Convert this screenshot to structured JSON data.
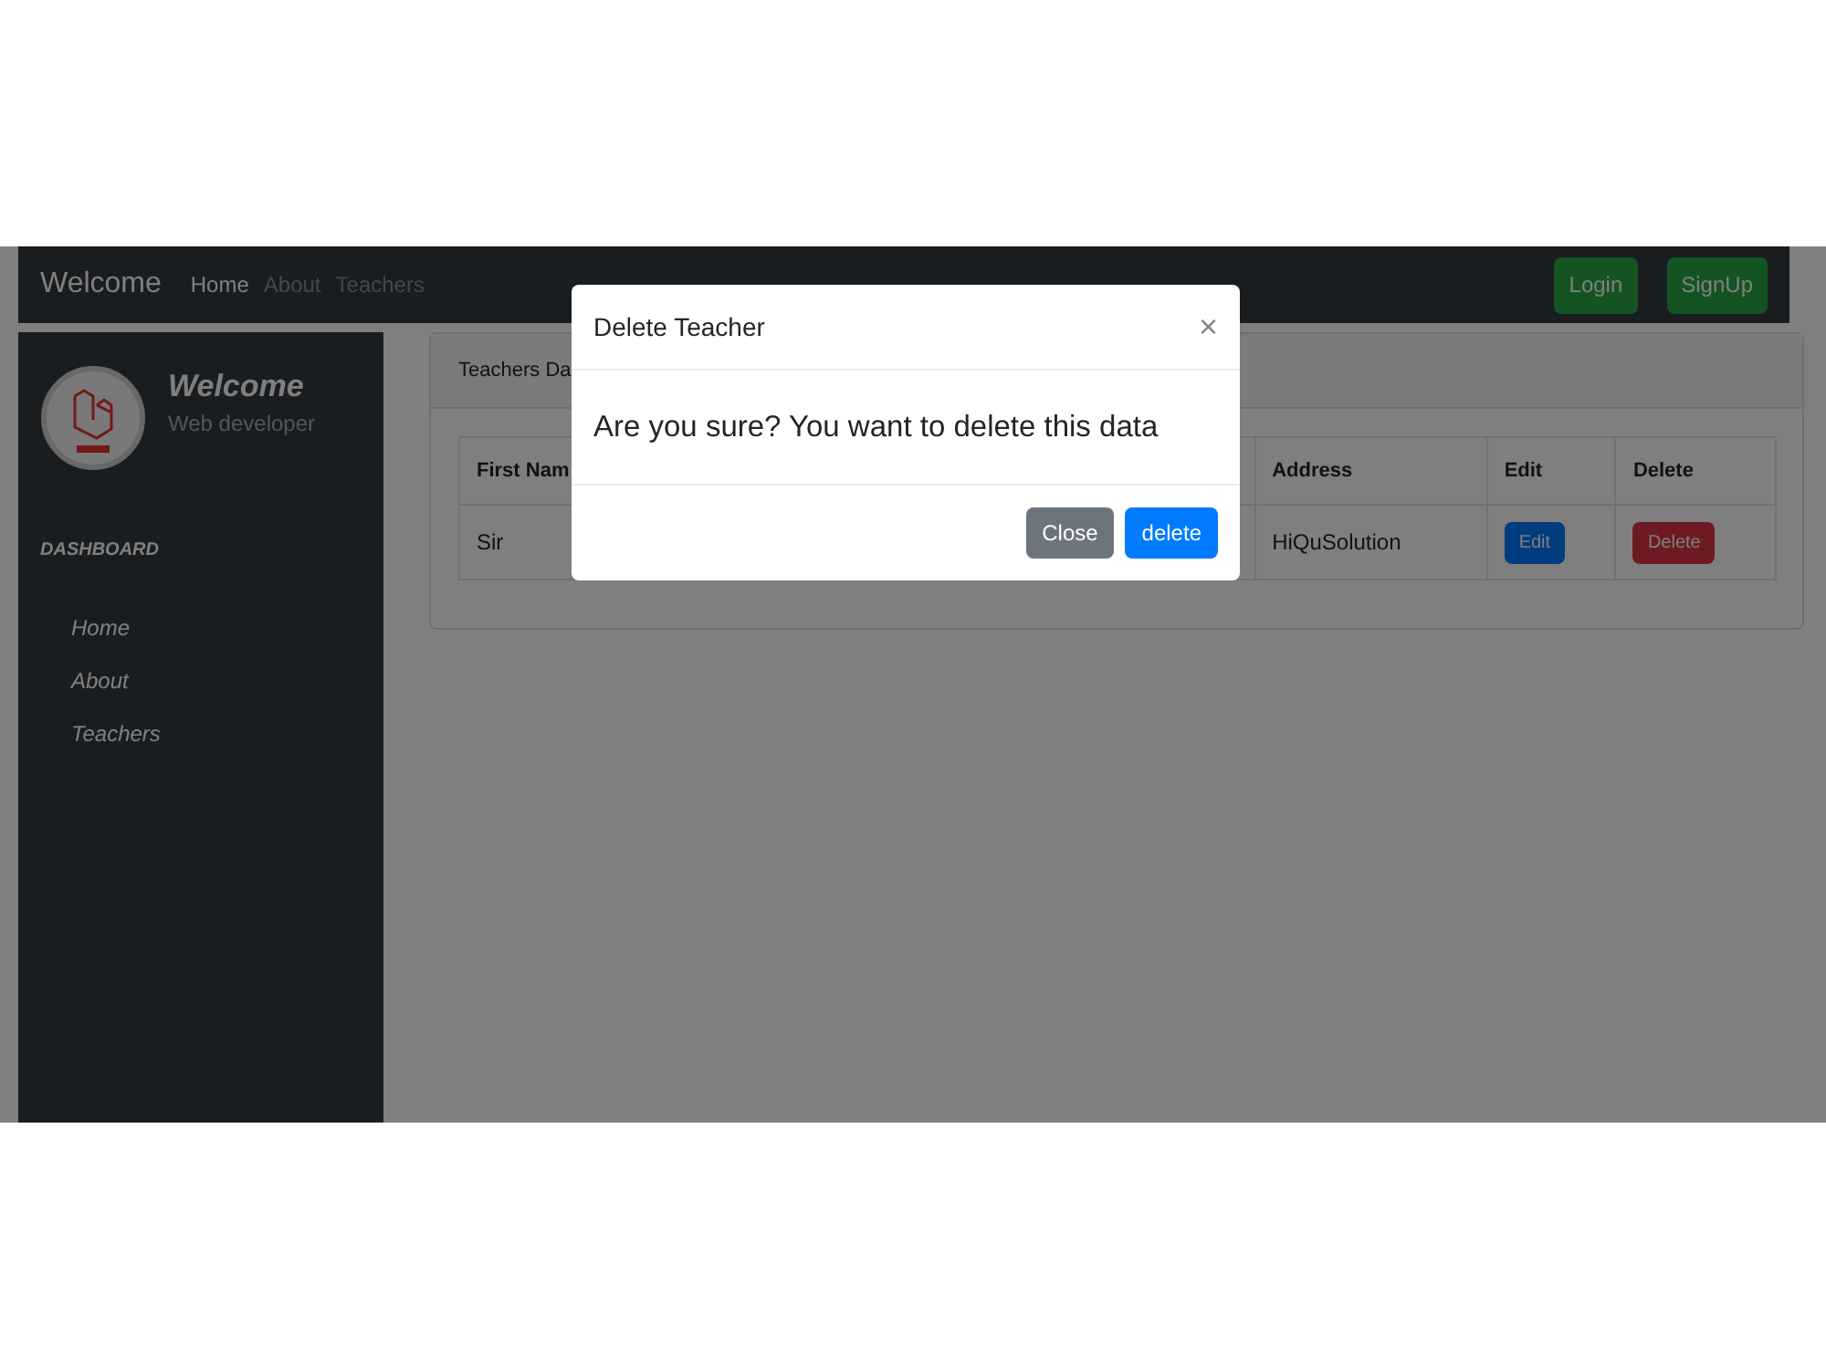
{
  "navbar": {
    "brand": "Welcome",
    "links": [
      {
        "label": "Home",
        "selected": true
      },
      {
        "label": "About",
        "selected": false
      },
      {
        "label": "Teachers",
        "selected": false
      }
    ],
    "buttons": [
      "Login",
      "SignUp"
    ]
  },
  "sidebar": {
    "title": "Welcome",
    "subtitle": "Web developer",
    "section": "DASHBOARD",
    "items": [
      "Home",
      "About",
      "Teachers"
    ]
  },
  "card": {
    "header": "Teachers Da"
  },
  "table": {
    "columns": [
      "First Nam",
      "Address",
      "Edit",
      "Delete"
    ],
    "rows": [
      {
        "cells": [
          {
            "kind": "text",
            "text": "Sir"
          },
          {
            "kind": "text",
            "text": "HiQuSolution"
          },
          {
            "kind": "button",
            "text": "Edit"
          },
          {
            "kind": "button",
            "text": "Delete"
          }
        ]
      }
    ]
  },
  "modal": {
    "title": "Delete Teacher",
    "close_icon": "×",
    "message": "Are you sure? You want to delete this data",
    "buttons": [
      "Close",
      "delete"
    ]
  }
}
